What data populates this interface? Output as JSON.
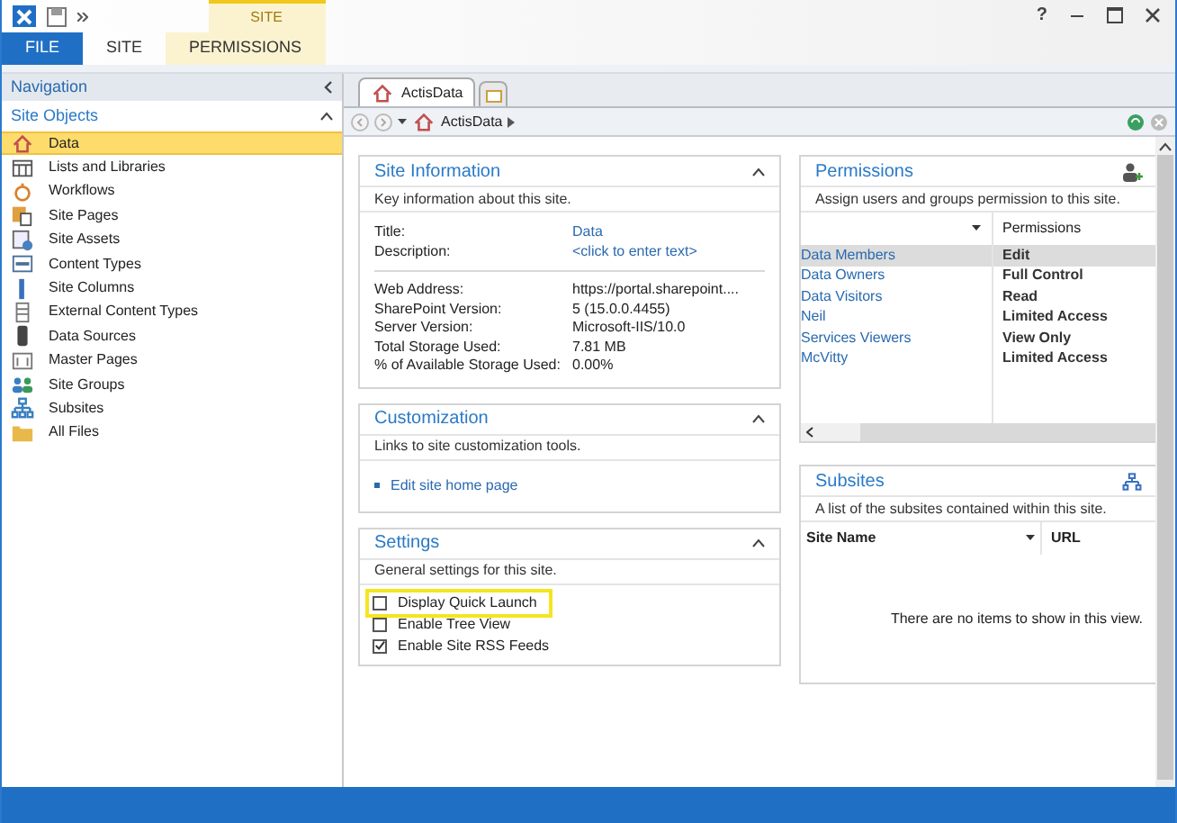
{
  "window": {
    "help": "?"
  },
  "ribbon": {
    "context_group": "SITE",
    "tabs": [
      {
        "label": "FILE",
        "kind": "file",
        "selected": false
      },
      {
        "label": "SITE",
        "kind": "plain",
        "selected": false
      },
      {
        "label": "PERMISSIONS",
        "kind": "context",
        "selected": false
      }
    ]
  },
  "navigation": {
    "title": "Navigation",
    "section": "Site Objects",
    "items": [
      {
        "label": "Data",
        "kind": "home",
        "selected": true
      },
      {
        "label": "Lists and Libraries",
        "kind": "list",
        "selected": false
      },
      {
        "label": "Workflows",
        "kind": "workflow",
        "selected": false
      },
      {
        "label": "Site Pages",
        "kind": "pages",
        "selected": false
      },
      {
        "label": "Site Assets",
        "kind": "assets",
        "selected": false
      },
      {
        "label": "Content Types",
        "kind": "types",
        "selected": false
      },
      {
        "label": "Site Columns",
        "kind": "column",
        "selected": false
      },
      {
        "label": "External Content Types",
        "kind": "external",
        "selected": false
      },
      {
        "label": "Data Sources",
        "kind": "db",
        "selected": false
      },
      {
        "label": "Master Pages",
        "kind": "master",
        "selected": false
      },
      {
        "label": "Site Groups",
        "kind": "groups",
        "selected": false
      },
      {
        "label": "Subsites",
        "kind": "tree",
        "selected": false
      },
      {
        "label": "All Files",
        "kind": "folder",
        "selected": false
      }
    ]
  },
  "doc_tabs": [
    {
      "label": "ActisData",
      "selected": true
    }
  ],
  "breadcrumb": "ActisData",
  "site_information": {
    "title": "Site Information",
    "description": "Key information about this site.",
    "fields": [
      {
        "label": "Title:",
        "value": "Data",
        "kind": "link"
      },
      {
        "label": "Description:",
        "value": "<click to enter text>",
        "kind": "link"
      }
    ],
    "details": [
      {
        "label": "Web Address:",
        "value": "https://portal.sharepoint...."
      },
      {
        "label": "SharePoint Version:",
        "value": "5 (15.0.0.4455)"
      },
      {
        "label": "Server Version:",
        "value": "Microsoft-IIS/10.0"
      },
      {
        "label": "Total Storage Used:",
        "value": "7.81 MB"
      },
      {
        "label": "% of Available Storage Used:",
        "value": "0.00%"
      }
    ]
  },
  "customization": {
    "title": "Customization",
    "description": "Links to site customization tools.",
    "links": [
      "Edit site home page"
    ]
  },
  "settings": {
    "title": "Settings",
    "description": "General settings for this site.",
    "options": [
      {
        "label": "Display Quick Launch",
        "checked": false,
        "focused": true
      },
      {
        "label": "Enable Tree View",
        "checked": false,
        "focused": false
      },
      {
        "label": "Enable Site RSS Feeds",
        "checked": true,
        "focused": false
      }
    ]
  },
  "permissions": {
    "title": "Permissions",
    "description": "Assign users and groups permission to this site.",
    "columns": [
      "Permissions"
    ],
    "rows": [
      {
        "name": "Data Members",
        "permission": "Edit",
        "selected": true
      },
      {
        "name": "Data Owners",
        "permission": "Full Control",
        "selected": false
      },
      {
        "name": "Data Visitors",
        "permission": "Read",
        "selected": false
      },
      {
        "name": "Neil",
        "permission": "Limited Access",
        "selected": false
      },
      {
        "name": "Services Viewers",
        "permission": "View Only",
        "selected": false
      },
      {
        "name": "McVitty",
        "permission": "Limited Access",
        "selected": false
      }
    ]
  },
  "subsites": {
    "title": "Subsites",
    "description": "A list of the subsites contained within this site.",
    "columns": [
      "Site Name",
      "URL"
    ],
    "empty": "There are no items to show in this view."
  }
}
